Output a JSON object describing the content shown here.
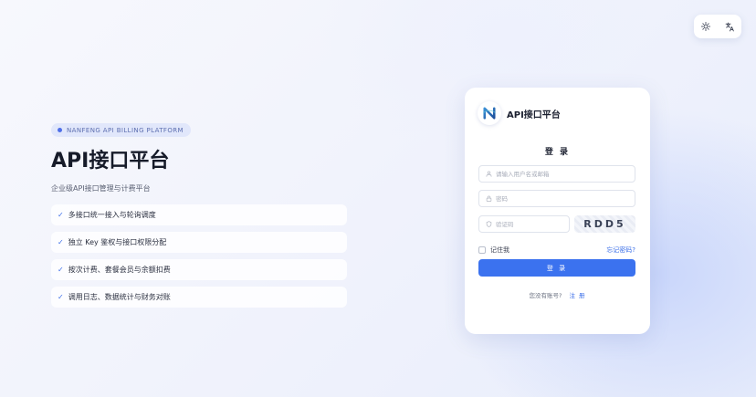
{
  "toolbar": {
    "theme_icon": "sun-icon",
    "language_icon": "translate-icon"
  },
  "hero": {
    "badge": "NANFENG API BILLING PLATFORM",
    "title": "API接口平台",
    "subtitle": "企业级API接口管理与计费平台",
    "features": [
      "多接口统一接入与轮询调度",
      "独立 Key 鉴权与接口权限分配",
      "按次计费、套餐会员与余额扣费",
      "调用日志、数据统计与财务对账"
    ]
  },
  "login": {
    "logo_letter": "N",
    "card_title": "API接口平台",
    "heading": "登 录",
    "username_placeholder": "请输入用户名或邮箱",
    "password_placeholder": "密码",
    "captcha_placeholder": "验证码",
    "captcha_text": "RDD5",
    "remember_label": "记住我",
    "forgot_label": "忘记密码?",
    "submit_label": "登 录",
    "no_account_text": "您没有账号?",
    "register_label": "注 册"
  },
  "colors": {
    "accent": "#3b72ef",
    "link": "#3b6fe8",
    "badge_bg": "#e1e7fb"
  }
}
